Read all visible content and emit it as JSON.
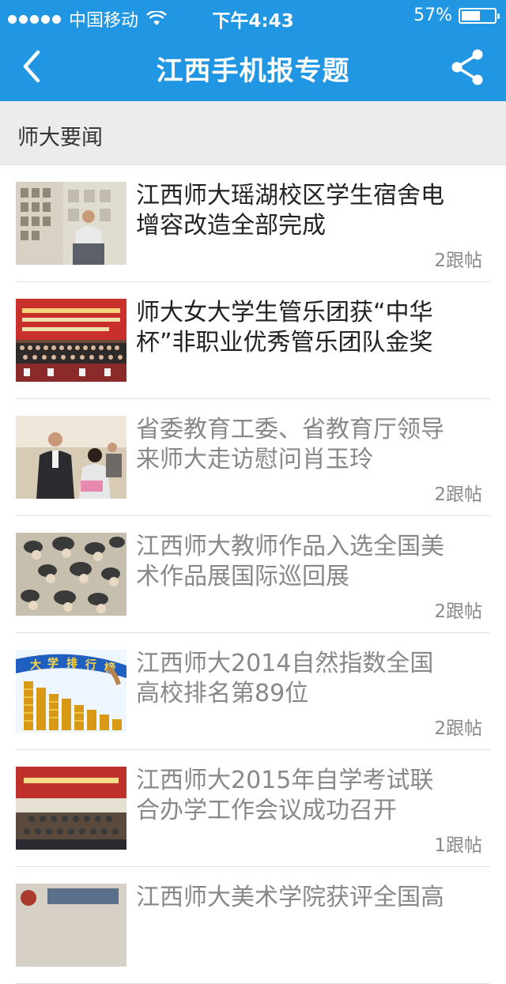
{
  "status_bar": {
    "carrier": "中国移动",
    "time": "下午4:43",
    "battery": "57%",
    "battery_level": 0.57
  },
  "nav": {
    "title": "江西手机报专题",
    "back_icon": "chevron-left-icon",
    "share_icon": "share-icon"
  },
  "section": {
    "title": "师大要闻"
  },
  "articles": [
    {
      "title_line1": "江西师大瑶湖校区学生宿舍电",
      "title_line2": "增容改造全部完成",
      "count": "2跟帖",
      "read": false
    },
    {
      "title_line1": "师大女大学生管乐团获“中华",
      "title_line2": "杯”非职业优秀管乐团队金奖",
      "count": "",
      "read": false
    },
    {
      "title_line1": "省委教育工委、省教育厅领导",
      "title_line2": "来师大走访慰问肖玉玲",
      "count": "2跟帖",
      "read": true
    },
    {
      "title_line1": "江西师大教师作品入选全国美",
      "title_line2": "术作品展国际巡回展",
      "count": "2跟帖",
      "read": true
    },
    {
      "title_line1": "江西师大2014自然指数全国",
      "title_line2": "高校排名第89位",
      "count": "2跟帖",
      "read": true
    },
    {
      "title_line1": "江西师大2015年自学考试联",
      "title_line2": "合办学工作会议成功召开",
      "count": "1跟帖",
      "read": true
    },
    {
      "title_line1": "江西师大美术学院获评全国高",
      "title_line2": "",
      "count": "",
      "read": true
    }
  ]
}
